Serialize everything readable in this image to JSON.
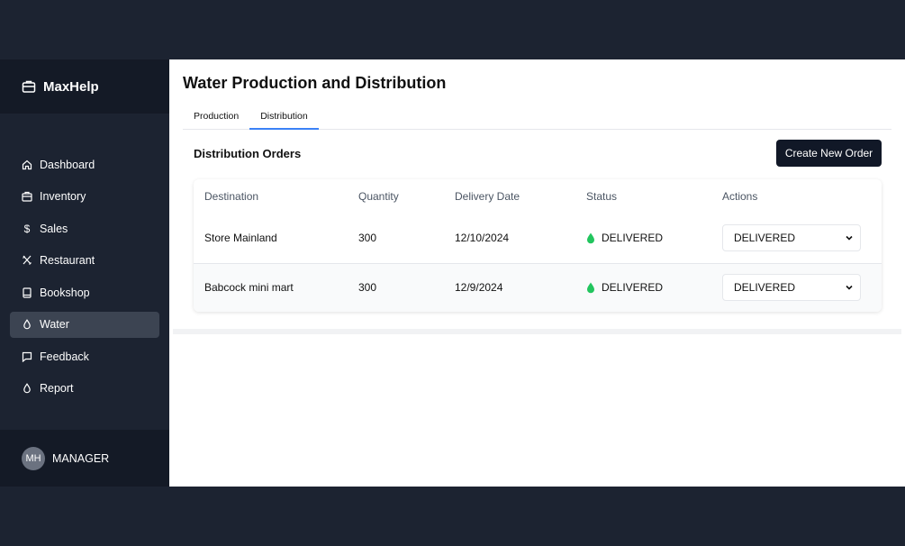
{
  "brand": {
    "name": "MaxHelp",
    "icon": "briefcase-icon"
  },
  "sidebar": {
    "items": [
      {
        "label": "Dashboard",
        "icon": "home-icon"
      },
      {
        "label": "Inventory",
        "icon": "box-icon"
      },
      {
        "label": "Sales",
        "icon": "dollar-icon"
      },
      {
        "label": "Restaurant",
        "icon": "utensils-icon"
      },
      {
        "label": "Bookshop",
        "icon": "book-icon"
      },
      {
        "label": "Water",
        "icon": "droplet-icon",
        "active": true
      },
      {
        "label": "Feedback",
        "icon": "message-icon"
      },
      {
        "label": "Report",
        "icon": "droplet-icon"
      }
    ]
  },
  "user": {
    "initials": "MH",
    "role": "MANAGER"
  },
  "main": {
    "title": "Water Production and Distribution",
    "tabs": [
      {
        "label": "Production"
      },
      {
        "label": "Distribution",
        "active": true
      }
    ],
    "section_title": "Distribution Orders",
    "create_button": "Create New Order",
    "table": {
      "columns": [
        "Destination",
        "Quantity",
        "Delivery Date",
        "Status",
        "Actions"
      ],
      "rows": [
        {
          "destination": "Store Mainland",
          "quantity": "300",
          "date": "12/10/2024",
          "status": "DELIVERED",
          "action": "DELIVERED"
        },
        {
          "destination": "Babcock mini mart",
          "quantity": "300",
          "date": "12/9/2024",
          "status": "DELIVERED",
          "action": "DELIVERED"
        }
      ]
    }
  },
  "colors": {
    "sidebar_bg": "#1c2331",
    "brand_bg": "#141a26",
    "active_nav": "#3c4452",
    "button_bg": "#111827",
    "tab_accent": "#3b82f6",
    "status_green": "#22c55e"
  }
}
